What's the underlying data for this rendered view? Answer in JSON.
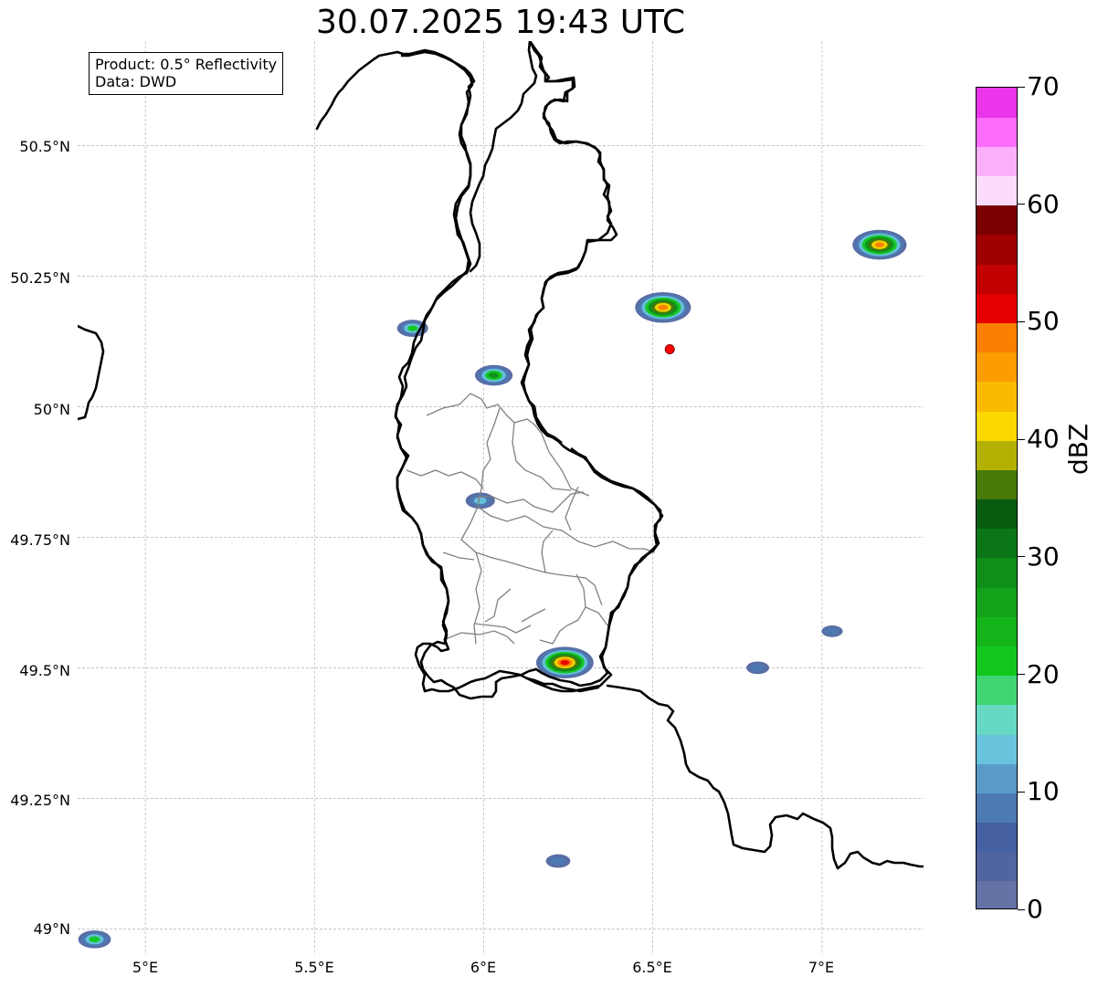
{
  "title": "30.07.2025 19:43 UTC",
  "info": {
    "product": "Product: 0.5° Reflectivity",
    "data": "Data: DWD"
  },
  "lat_labels": [
    "50.5°N",
    "50.25°N",
    "50°N",
    "49.75°N",
    "49.5°N",
    "49.25°N",
    "49°N"
  ],
  "lon_labels": [
    "5°E",
    "5.5°E",
    "6°E",
    "6.5°E",
    "7°E"
  ],
  "colorbar": {
    "label": "dBZ",
    "ticks": [
      "0",
      "10",
      "20",
      "30",
      "40",
      "50",
      "60",
      "70"
    ],
    "colors": [
      "#6472a6",
      "#5065a0",
      "#4561a1",
      "#4d7ab3",
      "#5a9bc8",
      "#68c4dc",
      "#66d9c4",
      "#3fd672",
      "#12c81e",
      "#13b51b",
      "#12a31a",
      "#0f8f18",
      "#0b7616",
      "#075c10",
      "#487a08",
      "#b3b204",
      "#fbd800",
      "#fbb900",
      "#fb9c00",
      "#fb7f00",
      "#e60000",
      "#c20000",
      "#9f0000",
      "#7b0000",
      "#fcdcfc",
      "#fcb0fc",
      "#fc6dfc",
      "#ea35ea"
    ]
  },
  "chart_data": {
    "type": "heatmap",
    "title": "30.07.2025 19:43 UTC",
    "xlabel": "",
    "ylabel": "",
    "xlim": [
      4.8,
      7.3
    ],
    "ylim": [
      48.95,
      50.7
    ],
    "x_ticks": [
      5.0,
      5.5,
      6.0,
      6.5,
      7.0
    ],
    "y_ticks": [
      49.0,
      49.25,
      49.5,
      49.75,
      50.0,
      50.25,
      50.5
    ],
    "grid": true,
    "colorbar_range": [
      0,
      70
    ],
    "radar_site": {
      "lon": 6.55,
      "lat": 50.11
    },
    "echoes": [
      {
        "lon": 6.24,
        "lat": 49.51,
        "max_dbz": 52
      },
      {
        "lon": 7.17,
        "lat": 50.31,
        "max_dbz": 48
      },
      {
        "lon": 6.53,
        "lat": 50.19,
        "max_dbz": 50
      },
      {
        "lon": 6.03,
        "lat": 50.06,
        "max_dbz": 28
      },
      {
        "lon": 5.99,
        "lat": 49.82,
        "max_dbz": 18
      },
      {
        "lon": 5.79,
        "lat": 50.15,
        "max_dbz": 20
      },
      {
        "lon": 6.81,
        "lat": 49.5,
        "max_dbz": 10
      },
      {
        "lon": 7.03,
        "lat": 49.57,
        "max_dbz": 8
      },
      {
        "lon": 6.22,
        "lat": 49.13,
        "max_dbz": 12
      },
      {
        "lon": 4.85,
        "lat": 48.98,
        "max_dbz": 22
      }
    ]
  }
}
